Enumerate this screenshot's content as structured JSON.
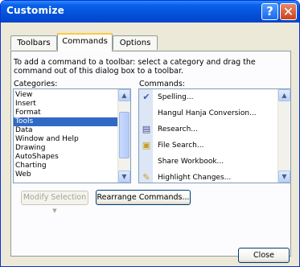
{
  "window": {
    "title": "Customize",
    "help_glyph": "?",
    "close_glyph": "✕"
  },
  "tabs": [
    {
      "label": "Toolbars",
      "active": false
    },
    {
      "label": "Commands",
      "active": true
    },
    {
      "label": "Options",
      "active": false
    }
  ],
  "instruction": "To add a command to a toolbar: select a category and drag the command out of this dialog box to a toolbar.",
  "categories_label": "Categories:",
  "categories": [
    "View",
    "Insert",
    "Format",
    "Tools",
    "Data",
    "Window and Help",
    "Drawing",
    "AutoShapes",
    "Charting",
    "Web"
  ],
  "selected_category": "Tools",
  "commands_label": "Commands:",
  "commands": [
    {
      "label": "Spelling...",
      "icon": "spelling-icon"
    },
    {
      "label": "Hangul Hanja Conversion...",
      "icon": ""
    },
    {
      "label": "Research...",
      "icon": "research-icon"
    },
    {
      "label": "File Search...",
      "icon": "file-search-icon"
    },
    {
      "label": "Share Workbook...",
      "icon": ""
    },
    {
      "label": "Highlight Changes...",
      "icon": "highlight-changes-icon"
    }
  ],
  "buttons": {
    "modify_selection": "Modify Selection",
    "rearrange_commands": "Rearrange Commands...",
    "close": "Close"
  },
  "colors": {
    "titlebar": "#0551DA",
    "selection": "#316AC5",
    "dialog_bg": "#ECE9D8"
  }
}
